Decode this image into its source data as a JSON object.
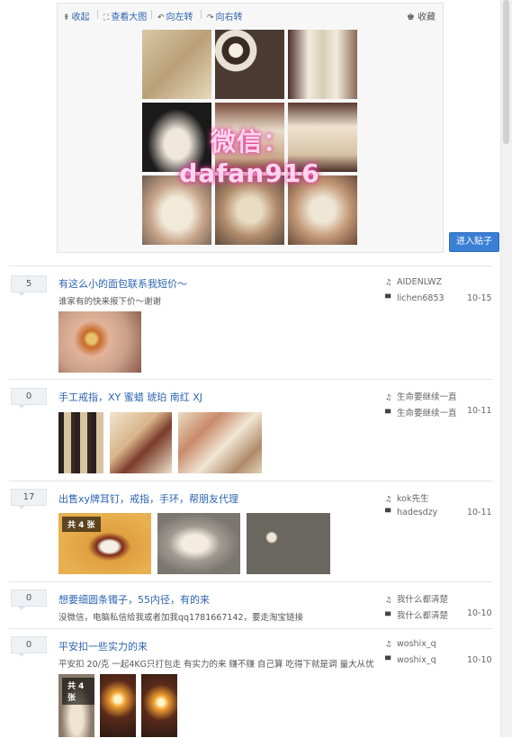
{
  "viewer": {
    "collapse": "收起",
    "view_large": "查看大图",
    "rotate_left": "向左转",
    "rotate_right": "向右转",
    "favorite": "收藏",
    "watermark": "微信：dafan916"
  },
  "enter_button": "进入贴子",
  "threads": [
    {
      "count": "5",
      "title": "有这么小的面包联系我短价～",
      "excerpt": "谁家有的快来报下价～谢谢",
      "author": "AIDENLWZ",
      "last_reply": "lichen6853",
      "date": "10-15",
      "images": 1,
      "badge": ""
    },
    {
      "count": "0",
      "title": "手工戒指，XY 蜜蜡 琥珀 南红 XJ",
      "excerpt": "",
      "author": "生命要继续一直",
      "last_reply": "生命要继续一直",
      "date": "10-11",
      "images": 3,
      "badge": ""
    },
    {
      "count": "17",
      "title": "出售xy牌耳钉，戒指，手环，帮朋友代理",
      "excerpt": "",
      "author": "kok先生",
      "last_reply": "hadesdzy",
      "date": "10-11",
      "images": 3,
      "badge": "共 4 张"
    },
    {
      "count": "0",
      "title": "想要细圆条镯子，55内径，有的来",
      "excerpt": "没微信，电脑私信给我或者加我qq1781667142，要走淘宝链接",
      "author": "我什么都清楚",
      "last_reply": "我什么都清楚",
      "date": "10-10",
      "images": 0,
      "badge": ""
    },
    {
      "count": "0",
      "title": "平安扣一些实力的来",
      "excerpt": "平安扣 20/克 一起4KG只打包走 有实力的来 赚不赚 自己算 吃得下就是调 量大从优",
      "author": "woshix_q",
      "last_reply": "woshix_q",
      "date": "10-10",
      "images": 3,
      "badge": "共 4 张"
    }
  ],
  "colors": {
    "link": "#2d64b3",
    "button": "#3a7fd5"
  }
}
